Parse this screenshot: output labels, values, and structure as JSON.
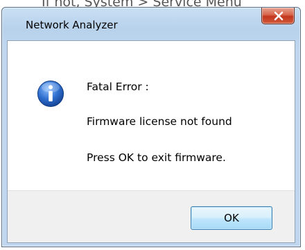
{
  "background": {
    "partial_text": "If not, System > Service Menu"
  },
  "window": {
    "title": "Network Analyzer",
    "close_icon": "close-x-icon"
  },
  "dialog": {
    "icon": "info-icon",
    "lines": [
      "Fatal Error :",
      "Firmware license not found",
      "Press OK to exit firmware."
    ],
    "ok_label": "OK"
  },
  "colors": {
    "info_icon_blue": "#1f5fb8",
    "close_button_red": "#c2361c",
    "title_bar_blue": "#bfd6ee"
  }
}
